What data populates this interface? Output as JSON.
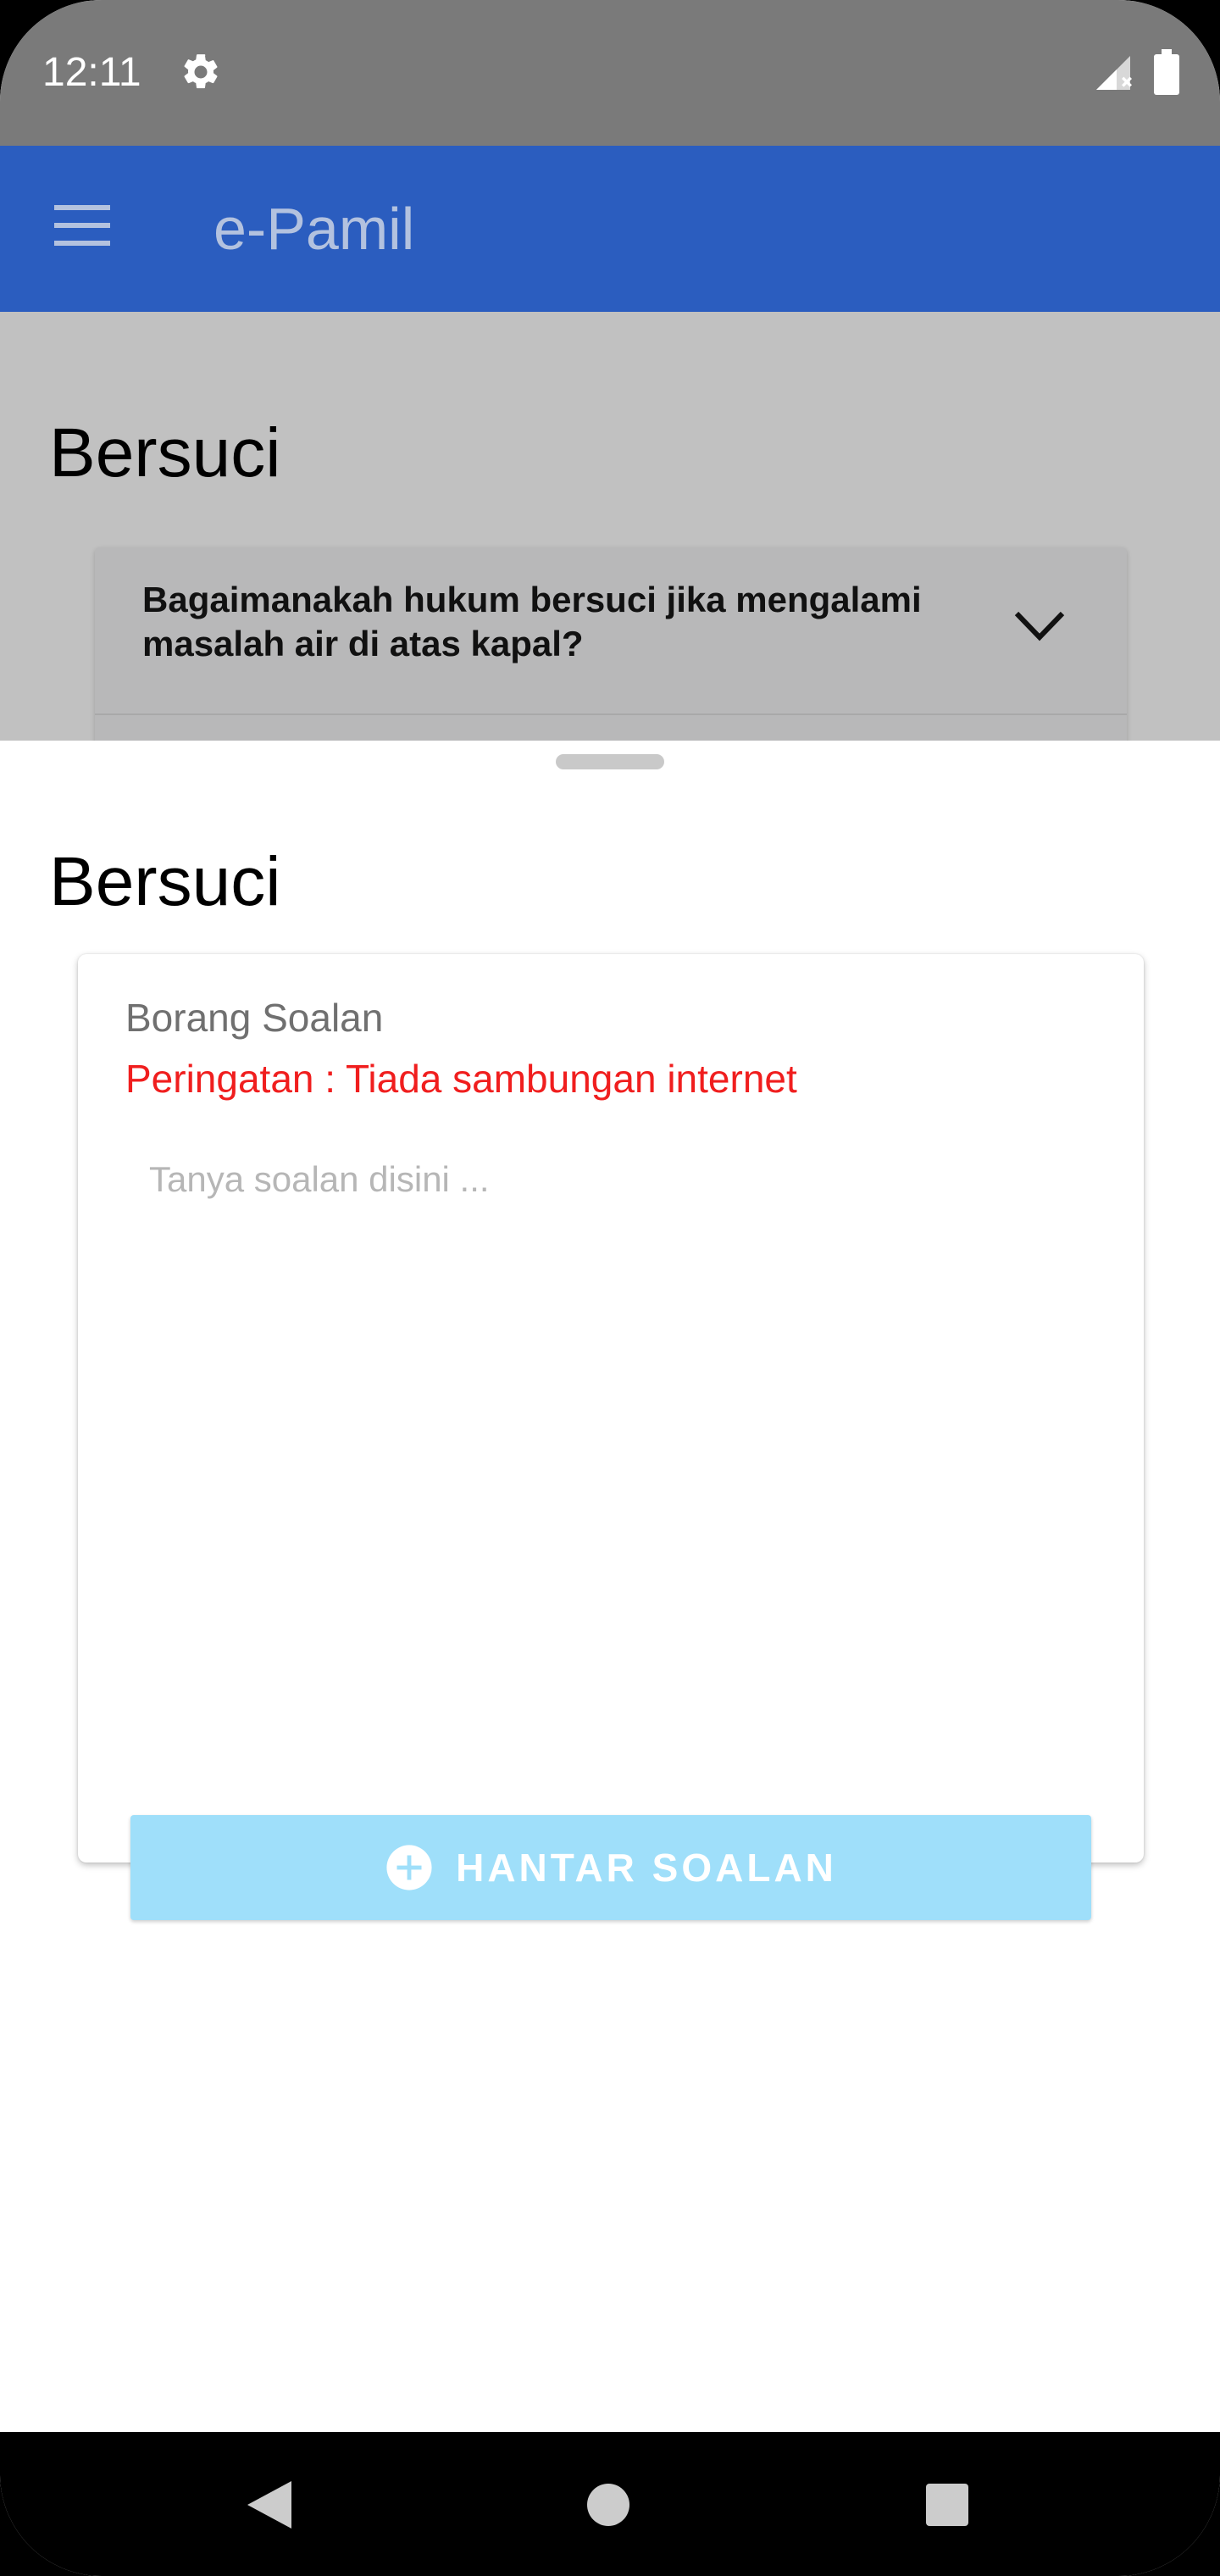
{
  "status_bar": {
    "time": "12:11",
    "icons": [
      "gear-icon",
      "signal-icon",
      "battery-icon"
    ]
  },
  "app_bar": {
    "title": "e-Pamil",
    "menu_icon": "menu-icon",
    "color": "#2b5dbf"
  },
  "background": {
    "heading": "Bersuci",
    "faq_items": [
      {
        "question": "Bagaimanakah hukum bersuci jika mengalami masalah air di atas kapal?"
      }
    ]
  },
  "sheet": {
    "heading": "Bersuci",
    "form": {
      "title": "Borang Soalan",
      "warning": "Peringatan : Tiada sambungan internet",
      "warning_color": "#f01e1e",
      "input_value": "",
      "input_placeholder": "Tanya soalan disini ...",
      "submit_label": "HANTAR SOALAN",
      "submit_color": "#9fdffa"
    }
  },
  "nav_bar": {
    "icons": [
      "back-icon",
      "home-icon",
      "recents-icon"
    ]
  }
}
